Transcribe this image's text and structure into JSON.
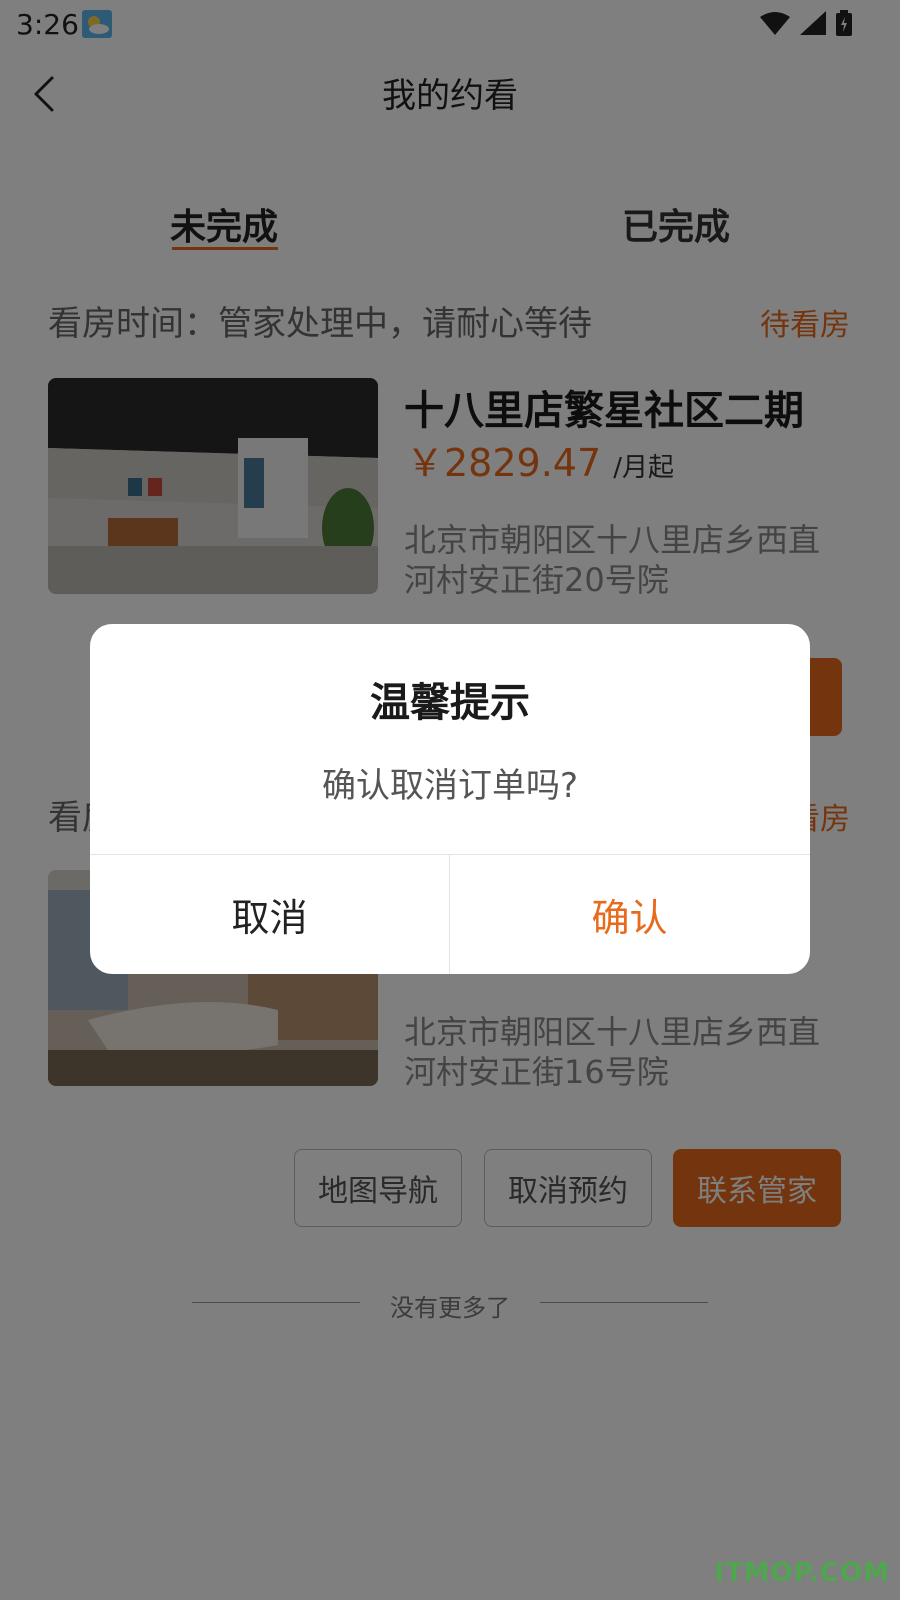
{
  "status_bar": {
    "time": "3:26"
  },
  "header": {
    "title": "我的约看"
  },
  "tabs": [
    {
      "label": "未完成",
      "active": true
    },
    {
      "label": "已完成",
      "active": false
    }
  ],
  "cards": [
    {
      "status_label": "看房时间：管家处理中，请耐心等待",
      "status_badge": "待看房",
      "title": "十八里店繁星社区二期",
      "price": "￥2829.47",
      "price_unit": "/月起",
      "address": "北京市朝阳区十八里店乡西直河村安正街20号院"
    },
    {
      "status_label": "看房时间：",
      "status_badge": "待看房",
      "address": "北京市朝阳区十八里店乡西直河村安正街16号院",
      "buttons": {
        "navigate": "地图导航",
        "cancel": "取消预约",
        "contact": "联系管家"
      }
    }
  ],
  "footer": {
    "no_more": "没有更多了"
  },
  "dialog": {
    "title": "温馨提示",
    "message": "确认取消订单吗?",
    "cancel_label": "取消",
    "confirm_label": "确认"
  },
  "watermark": "ITMOP.COM",
  "colors": {
    "accent": "#e86a1c",
    "overlay": "rgba(0,0,0,0.5)"
  }
}
